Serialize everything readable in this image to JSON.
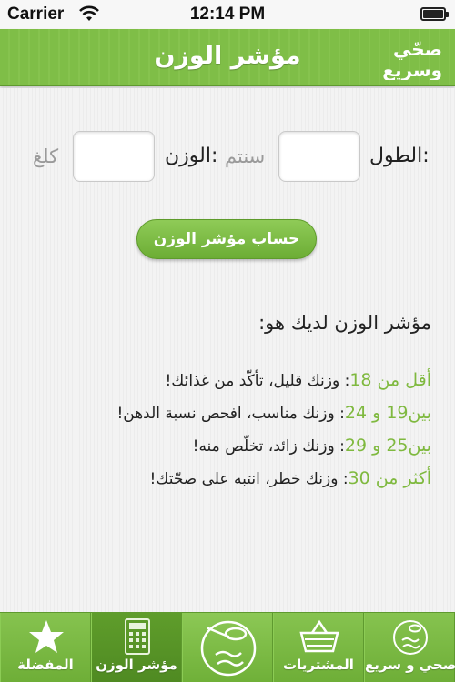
{
  "status_bar": {
    "carrier": "Carrier",
    "time": "12:14 PM"
  },
  "nav": {
    "title": "مؤشر الوزن",
    "logo_text_top": "صحّي",
    "logo_text_bottom": "وسريع"
  },
  "form": {
    "height_label": "الطول:",
    "height_unit": "سنتم",
    "height_value": "",
    "weight_label": "الوزن:",
    "weight_unit": "كلغ",
    "weight_value": "",
    "calculate_label": "حساب مؤشر الوزن"
  },
  "result": {
    "heading": "مؤشر الوزن لديك هو:",
    "scale": [
      {
        "range": "أقل من 18",
        "message": ": وزنك قليل، تأكّد من غذائك!"
      },
      {
        "range": "بين19 و 24",
        "message": ": وزنك مناسب، افحص نسبة الدهن!"
      },
      {
        "range": "بين25 و 29",
        "message": ": وزنك زائد، تخلّص منه!"
      },
      {
        "range": "أكثر من 30",
        "message": ": وزنك خطر، انتبه على صحّتك!"
      }
    ]
  },
  "tabs": [
    {
      "label": "المفضلة",
      "icon": "star-icon"
    },
    {
      "label": "مؤشر الوزن",
      "icon": "calculator-icon",
      "active": true
    },
    {
      "label": "",
      "icon": "logo-spoon-icon"
    },
    {
      "label": "المشتريات",
      "icon": "basket-icon"
    },
    {
      "label": "صحي و سريع",
      "icon": "logo-badge-icon"
    }
  ],
  "colors": {
    "brand_green": "#7fbe47",
    "accent_green_text": "#7fb93f",
    "tab_active": "#4f8a22"
  }
}
